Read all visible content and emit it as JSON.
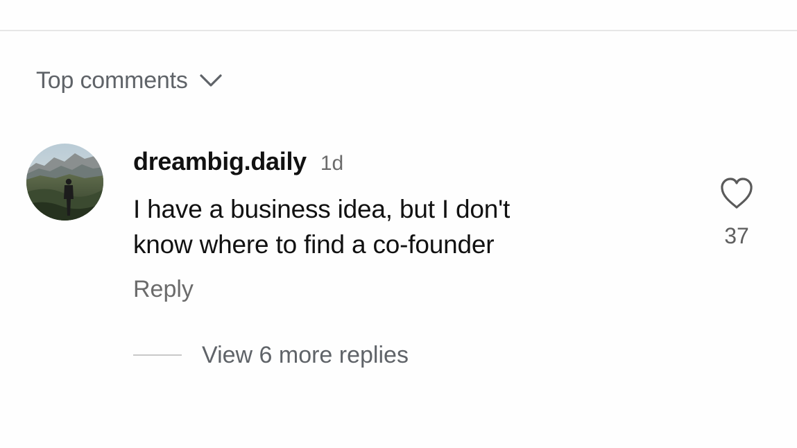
{
  "comments_section": {
    "sort_label": "Top comments",
    "sort_icon": "chevron-down-icon"
  },
  "comment": {
    "username": "dreambig.daily",
    "timestamp": "1d",
    "text_lines": [
      "I have a business idea, but I don't",
      "know where to find a co-founder"
    ],
    "reply_label": "Reply",
    "like_icon": "heart-outline-icon",
    "like_count": "37",
    "view_replies_label": "View 6 more replies"
  },
  "colors": {
    "background": "#fefefe",
    "primary_text": "#111111",
    "secondary_text": "#5f6368",
    "divider": "#e6e6e6"
  }
}
